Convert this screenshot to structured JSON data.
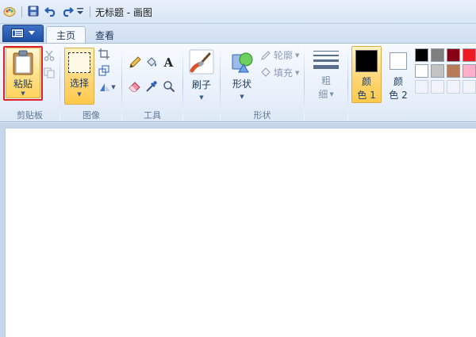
{
  "titlebar": {
    "title": "无标题 - 画图"
  },
  "tabs": [
    {
      "label": "主页",
      "active": true
    },
    {
      "label": "查看",
      "active": false
    }
  ],
  "clipboard": {
    "paste_label": "粘贴",
    "group_label": "剪贴板"
  },
  "image": {
    "select_label": "选择",
    "group_label": "图像"
  },
  "tools": {
    "group_label": "工具"
  },
  "brushes": {
    "label": "刷子"
  },
  "shapes": {
    "shapes_label": "形状",
    "outline_label": "轮廓",
    "fill_label": "填充",
    "group_label": "形状"
  },
  "size": {
    "label_line1": "粗",
    "label_line2": "细"
  },
  "colors": {
    "color1_line1": "颜",
    "color1_line2": "色 1",
    "color2_line1": "颜",
    "color2_line2": "色 2",
    "color1_value": "#000000",
    "color2_value": "#ffffff",
    "palette_row1": [
      "#000000",
      "#7f7f7f",
      "#880015",
      "#ed1c24"
    ],
    "palette_row2": [
      "#ffffff",
      "#c3c3c3",
      "#b97a57",
      "#ffaec9"
    ],
    "palette_row3": [
      "#f0f4fa",
      "#f0f4fa",
      "#f0f4fa",
      "#f0f4fa"
    ]
  },
  "highlight_color": "#e0202a"
}
